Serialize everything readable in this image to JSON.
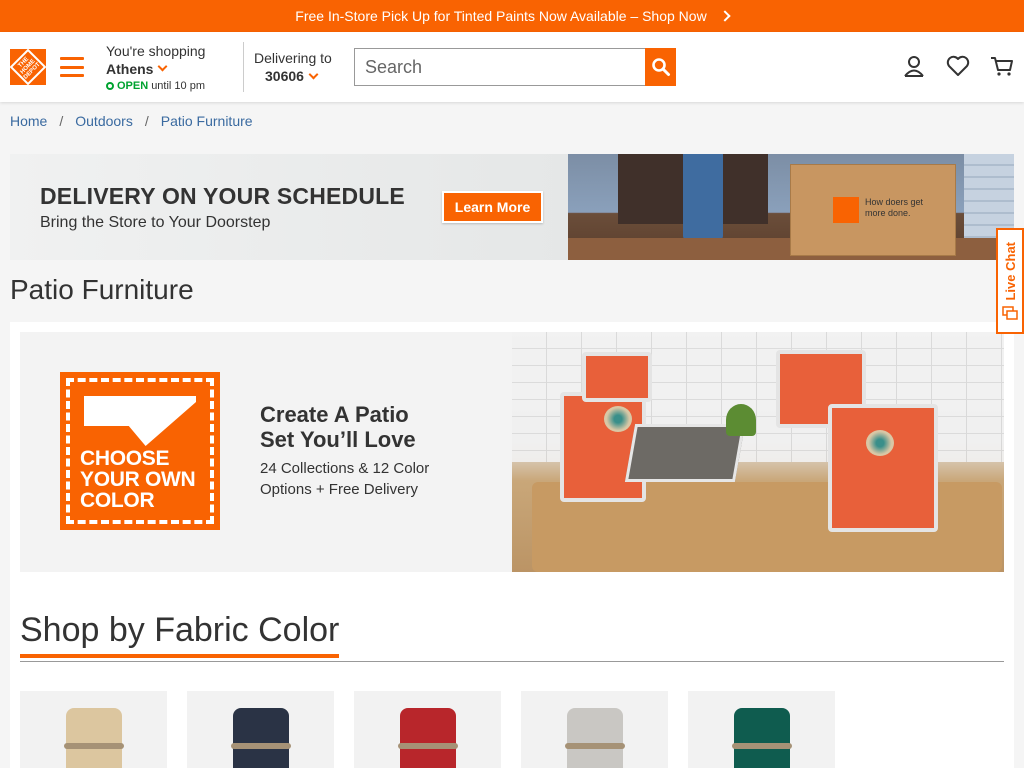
{
  "promo": {
    "text": "Free In-Store Pick Up for Tinted Paints Now Available – Shop Now"
  },
  "header": {
    "logo_text": "THE HOME DEPOT",
    "store": {
      "label": "You're shopping",
      "name": "Athens",
      "status": "OPEN",
      "hours": "until 10 pm"
    },
    "delivery": {
      "label": "Delivering to",
      "zip": "30606"
    },
    "search": {
      "placeholder": "Search"
    }
  },
  "breadcrumb": {
    "items": [
      "Home",
      "Outdoors",
      "Patio Furniture"
    ],
    "separator": "/"
  },
  "banner": {
    "headline": "DELIVERY ON YOUR SCHEDULE",
    "subhead": "Bring the Store to Your Doorstep",
    "button": "Learn More",
    "box_text": "How doers get more done."
  },
  "live_chat": {
    "label": "Live Chat"
  },
  "page": {
    "title": "Patio Furniture"
  },
  "hero": {
    "stamp_text": "CHOOSE YOUR OWN COLOR",
    "headline_1": "Create A Patio",
    "headline_2": "Set You’ll Love",
    "desc_1": "24 Collections & 12 Color",
    "desc_2": "Options + Free Delivery"
  },
  "fabric": {
    "heading": "Shop by Fabric Color",
    "swatches": [
      {
        "name": "beige",
        "color": "#dcc69f"
      },
      {
        "name": "navy",
        "color": "#2a3345"
      },
      {
        "name": "red",
        "color": "#b8262b"
      },
      {
        "name": "gray",
        "color": "#c9c7c3"
      },
      {
        "name": "green",
        "color": "#0f5c4f"
      }
    ]
  },
  "colors": {
    "brand": "#f96302",
    "open_green": "#00a330",
    "link": "#3a6aa0"
  }
}
